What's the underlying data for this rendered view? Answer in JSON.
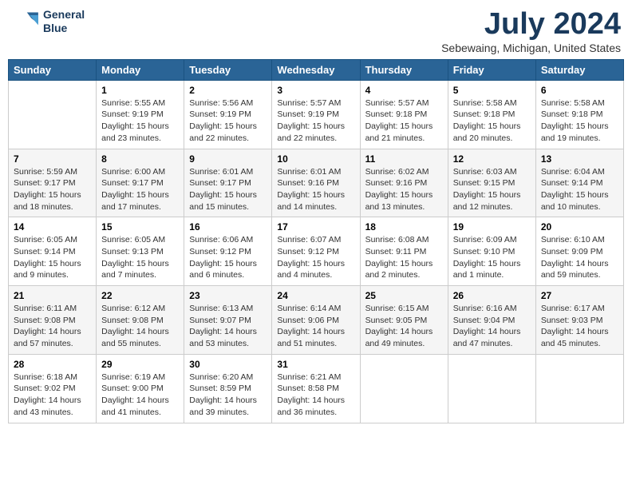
{
  "header": {
    "logo_line1": "General",
    "logo_line2": "Blue",
    "main_title": "July 2024",
    "subtitle": "Sebewaing, Michigan, United States"
  },
  "calendar": {
    "days_of_week": [
      "Sunday",
      "Monday",
      "Tuesday",
      "Wednesday",
      "Thursday",
      "Friday",
      "Saturday"
    ],
    "weeks": [
      [
        {
          "day": "",
          "content": ""
        },
        {
          "day": "1",
          "content": "Sunrise: 5:55 AM\nSunset: 9:19 PM\nDaylight: 15 hours\nand 23 minutes."
        },
        {
          "day": "2",
          "content": "Sunrise: 5:56 AM\nSunset: 9:19 PM\nDaylight: 15 hours\nand 22 minutes."
        },
        {
          "day": "3",
          "content": "Sunrise: 5:57 AM\nSunset: 9:19 PM\nDaylight: 15 hours\nand 22 minutes."
        },
        {
          "day": "4",
          "content": "Sunrise: 5:57 AM\nSunset: 9:18 PM\nDaylight: 15 hours\nand 21 minutes."
        },
        {
          "day": "5",
          "content": "Sunrise: 5:58 AM\nSunset: 9:18 PM\nDaylight: 15 hours\nand 20 minutes."
        },
        {
          "day": "6",
          "content": "Sunrise: 5:58 AM\nSunset: 9:18 PM\nDaylight: 15 hours\nand 19 minutes."
        }
      ],
      [
        {
          "day": "7",
          "content": "Sunrise: 5:59 AM\nSunset: 9:17 PM\nDaylight: 15 hours\nand 18 minutes."
        },
        {
          "day": "8",
          "content": "Sunrise: 6:00 AM\nSunset: 9:17 PM\nDaylight: 15 hours\nand 17 minutes."
        },
        {
          "day": "9",
          "content": "Sunrise: 6:01 AM\nSunset: 9:17 PM\nDaylight: 15 hours\nand 15 minutes."
        },
        {
          "day": "10",
          "content": "Sunrise: 6:01 AM\nSunset: 9:16 PM\nDaylight: 15 hours\nand 14 minutes."
        },
        {
          "day": "11",
          "content": "Sunrise: 6:02 AM\nSunset: 9:16 PM\nDaylight: 15 hours\nand 13 minutes."
        },
        {
          "day": "12",
          "content": "Sunrise: 6:03 AM\nSunset: 9:15 PM\nDaylight: 15 hours\nand 12 minutes."
        },
        {
          "day": "13",
          "content": "Sunrise: 6:04 AM\nSunset: 9:14 PM\nDaylight: 15 hours\nand 10 minutes."
        }
      ],
      [
        {
          "day": "14",
          "content": "Sunrise: 6:05 AM\nSunset: 9:14 PM\nDaylight: 15 hours\nand 9 minutes."
        },
        {
          "day": "15",
          "content": "Sunrise: 6:05 AM\nSunset: 9:13 PM\nDaylight: 15 hours\nand 7 minutes."
        },
        {
          "day": "16",
          "content": "Sunrise: 6:06 AM\nSunset: 9:12 PM\nDaylight: 15 hours\nand 6 minutes."
        },
        {
          "day": "17",
          "content": "Sunrise: 6:07 AM\nSunset: 9:12 PM\nDaylight: 15 hours\nand 4 minutes."
        },
        {
          "day": "18",
          "content": "Sunrise: 6:08 AM\nSunset: 9:11 PM\nDaylight: 15 hours\nand 2 minutes."
        },
        {
          "day": "19",
          "content": "Sunrise: 6:09 AM\nSunset: 9:10 PM\nDaylight: 15 hours\nand 1 minute."
        },
        {
          "day": "20",
          "content": "Sunrise: 6:10 AM\nSunset: 9:09 PM\nDaylight: 14 hours\nand 59 minutes."
        }
      ],
      [
        {
          "day": "21",
          "content": "Sunrise: 6:11 AM\nSunset: 9:08 PM\nDaylight: 14 hours\nand 57 minutes."
        },
        {
          "day": "22",
          "content": "Sunrise: 6:12 AM\nSunset: 9:08 PM\nDaylight: 14 hours\nand 55 minutes."
        },
        {
          "day": "23",
          "content": "Sunrise: 6:13 AM\nSunset: 9:07 PM\nDaylight: 14 hours\nand 53 minutes."
        },
        {
          "day": "24",
          "content": "Sunrise: 6:14 AM\nSunset: 9:06 PM\nDaylight: 14 hours\nand 51 minutes."
        },
        {
          "day": "25",
          "content": "Sunrise: 6:15 AM\nSunset: 9:05 PM\nDaylight: 14 hours\nand 49 minutes."
        },
        {
          "day": "26",
          "content": "Sunrise: 6:16 AM\nSunset: 9:04 PM\nDaylight: 14 hours\nand 47 minutes."
        },
        {
          "day": "27",
          "content": "Sunrise: 6:17 AM\nSunset: 9:03 PM\nDaylight: 14 hours\nand 45 minutes."
        }
      ],
      [
        {
          "day": "28",
          "content": "Sunrise: 6:18 AM\nSunset: 9:02 PM\nDaylight: 14 hours\nand 43 minutes."
        },
        {
          "day": "29",
          "content": "Sunrise: 6:19 AM\nSunset: 9:00 PM\nDaylight: 14 hours\nand 41 minutes."
        },
        {
          "day": "30",
          "content": "Sunrise: 6:20 AM\nSunset: 8:59 PM\nDaylight: 14 hours\nand 39 minutes."
        },
        {
          "day": "31",
          "content": "Sunrise: 6:21 AM\nSunset: 8:58 PM\nDaylight: 14 hours\nand 36 minutes."
        },
        {
          "day": "",
          "content": ""
        },
        {
          "day": "",
          "content": ""
        },
        {
          "day": "",
          "content": ""
        }
      ]
    ]
  }
}
